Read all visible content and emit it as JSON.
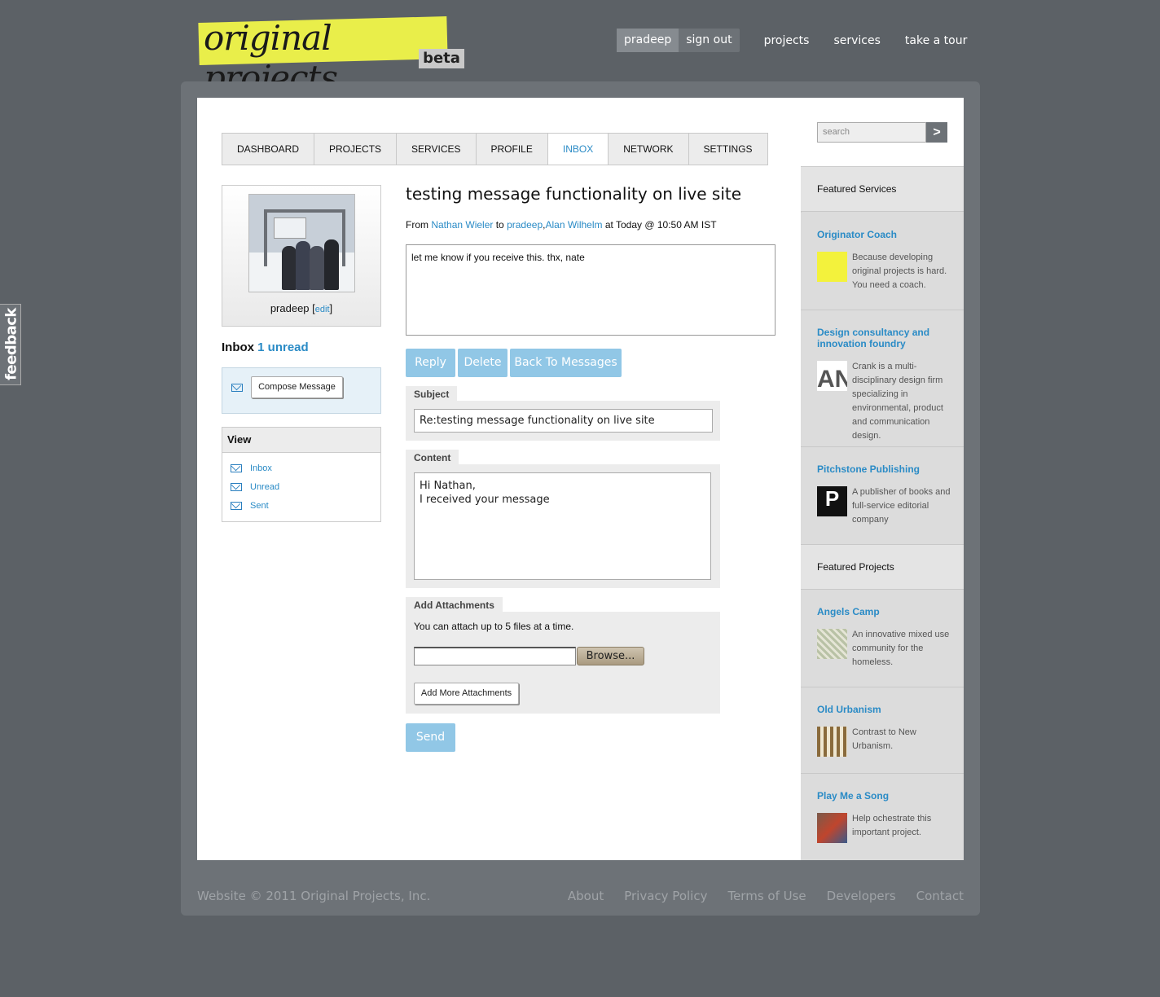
{
  "header": {
    "logo_text": "original projects",
    "logo_tag": "beta",
    "user": "pradeep",
    "signout": "sign out",
    "nav": [
      "projects",
      "services",
      "take a tour"
    ]
  },
  "tabs": [
    "DASHBOARD",
    "PROJECTS",
    "SERVICES",
    "PROFILE",
    "INBOX",
    "NETWORK",
    "SETTINGS"
  ],
  "active_tab": "INBOX",
  "profile": {
    "name": "pradeep",
    "edit": "edit"
  },
  "inbox": {
    "label": "Inbox",
    "unread": "1 unread",
    "compose": "Compose Message"
  },
  "view": {
    "title": "View",
    "items": [
      "Inbox",
      "Unread",
      "Sent"
    ]
  },
  "message": {
    "title": "testing message functionality on live site",
    "from_label": "From",
    "from": "Nathan Wieler",
    "to_label": "to",
    "to1": "pradeep",
    "to2": "Alan Wilhelm",
    "time": "at Today @ 10:50 AM IST",
    "body": "let me know if you receive this. thx, nate"
  },
  "actions": {
    "reply": "Reply",
    "delete": "Delete",
    "back": "Back To Messages"
  },
  "form": {
    "subject_label": "Subject",
    "subject_value": "Re:testing message functionality on live site",
    "content_label": "Content",
    "content_value": "Hi Nathan,\nI received your message",
    "attach_label": "Add Attachments",
    "attach_note": "You can attach up to 5 files at a time.",
    "browse": "Browse...",
    "add_more": "Add More Attachments",
    "send": "Send"
  },
  "sidebar": {
    "search_placeholder": "search",
    "featured_services": "Featured Services",
    "services": [
      {
        "title": "Originator Coach",
        "desc": "Because developing original projects is hard. You need a coach."
      },
      {
        "title": "Design consultancy and innovation foundry",
        "desc": "Crank is a multi-disciplinary design firm specializing in environmental, product and communication design.",
        "thumb_text": "AN"
      },
      {
        "title": "Pitchstone Publishing",
        "desc": "A publisher of books and full-service editorial company",
        "thumb_text": "P"
      }
    ],
    "featured_projects": "Featured Projects",
    "projects": [
      {
        "title": "Angels Camp",
        "desc": "An innovative mixed use community for the homeless."
      },
      {
        "title": "Old Urbanism",
        "desc": "Contrast to New Urbanism."
      },
      {
        "title": "Play Me a Song",
        "desc": "Help ochestrate this important project."
      }
    ]
  },
  "footer": {
    "copyright": "Website © 2011 Original Projects, Inc.",
    "links": [
      "About",
      "Privacy Policy",
      "Terms of Use",
      "Developers",
      "Contact"
    ]
  },
  "feedback": "feedback",
  "colors": {
    "accent": "#2a8bc6",
    "button": "#91c7e6",
    "logo_highlight": "#e9ee4a",
    "frame": "#6d7277"
  }
}
